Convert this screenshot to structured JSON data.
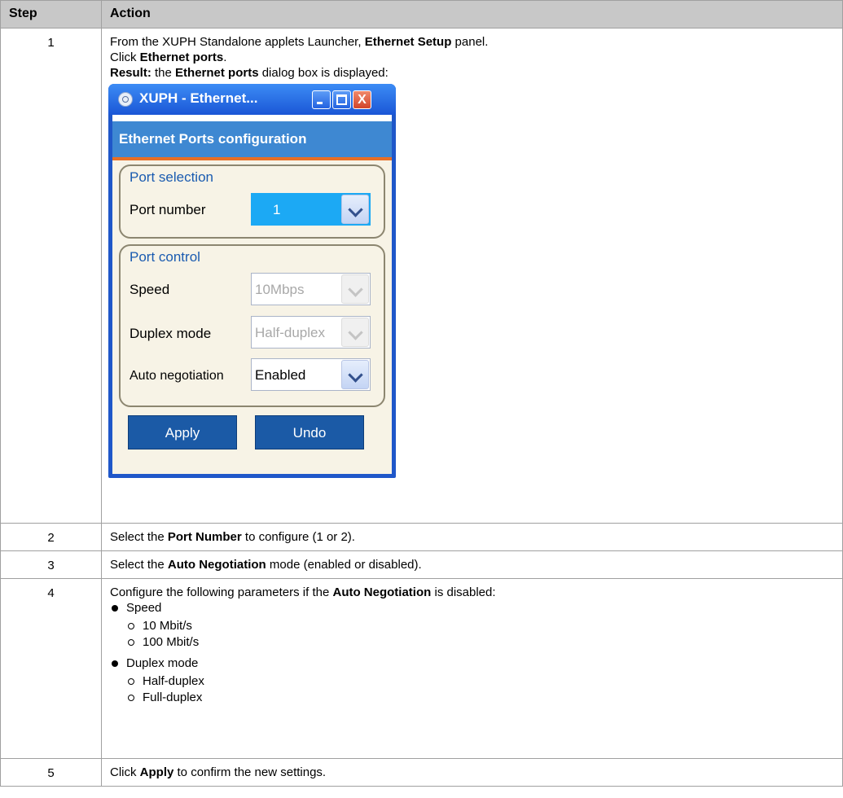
{
  "table": {
    "headers": {
      "step": "Step",
      "action": "Action"
    },
    "rows": [
      {
        "step": "1",
        "line1": {
          "pre": "From the XUPH Standalone applets Launcher, ",
          "bold": "Ethernet Setup",
          "post": " panel."
        },
        "line2": {
          "pre": "Click ",
          "bold": "Ethernet ports",
          "post": "."
        },
        "line3": {
          "bold1": "Result:",
          "mid": " the ",
          "bold2": "Ethernet ports",
          "post": " dialog box is displayed:"
        }
      },
      {
        "step": "2",
        "pre": "Select the ",
        "bold": "Port Number",
        "post": " to configure (1 or 2)."
      },
      {
        "step": "3",
        "pre": "Select the ",
        "bold": "Auto Negotiation",
        "post": " mode (enabled or disabled)."
      },
      {
        "step": "4",
        "pre": "Configure the following parameters if the ",
        "bold": "Auto Negotiation",
        "post": " is disabled:",
        "bullets": [
          {
            "label": "Speed",
            "options": [
              "10 Mbit/s",
              "100 Mbit/s"
            ]
          },
          {
            "label": "Duplex mode",
            "options": [
              "Half-duplex",
              "Full-duplex"
            ]
          }
        ]
      },
      {
        "step": "5",
        "pre": "Click ",
        "bold": "Apply",
        "post": " to confirm the new settings."
      }
    ]
  },
  "dialog": {
    "title": "XUPH - Ethernet...",
    "close_glyph": "X",
    "header": "Ethernet Ports configuration",
    "port_selection": {
      "group_label": "Port selection",
      "port_number_label": "Port number",
      "port_number_value": "1"
    },
    "port_control": {
      "group_label": "Port control",
      "speed_label": "Speed",
      "speed_value": "10Mbps",
      "duplex_label": "Duplex mode",
      "duplex_value": "Half-duplex",
      "auto_label": "Auto negotiation",
      "auto_value": "Enabled"
    },
    "buttons": {
      "apply": "Apply",
      "undo": "Undo"
    },
    "colors": {
      "title_bar": "#1a56d6",
      "header": "#3e88d2",
      "accent": "#e86e24",
      "button": "#1b5aa6",
      "selected": "#1ca9f4"
    }
  }
}
